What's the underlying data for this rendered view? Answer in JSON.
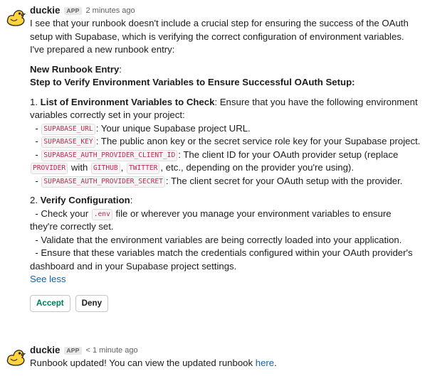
{
  "messages": [
    {
      "username": "duckie",
      "badge": "APP",
      "timestamp": "2 minutes ago",
      "intro": "I see that your runbook doesn't include a crucial step for ensuring the success of the OAuth setup with Supabase, which is verifying the correct configuration of environment variables. I've prepared a new runbook entry:",
      "entry_label": "New Runbook Entry",
      "entry_colon": ":",
      "step_title": "Step to Verify Environment Variables to Ensure Successful OAuth Setup:",
      "section1": {
        "number": "1. ",
        "title": "List of Environment Variables to Check",
        "text": ": Ensure that you have the following environment variables correctly set in your project:",
        "items": [
          {
            "dash": "- ",
            "code": "SUPABASE_URL",
            "text": ": Your unique Supabase project URL."
          },
          {
            "dash": "- ",
            "code": "SUPABASE_KEY",
            "text": ": The public anon key or the secret service role key for your Supabase project."
          },
          {
            "dash": "- ",
            "code": "SUPABASE_AUTH_PROVIDER_CLIENT_ID",
            "text": ": The client ID for your OAuth provider setup (replace ",
            "code2": "PROVIDER",
            "text2": " with ",
            "code3": "GITHUB",
            "text3": ", ",
            "code4": "TWITTER",
            "text4": ", etc., depending on the provider you're using)."
          },
          {
            "dash": "- ",
            "code": "SUPABASE_AUTH_PROVIDER_SECRET",
            "text": ": The client secret for your OAuth setup with the provider."
          }
        ]
      },
      "section2": {
        "number": "2. ",
        "title": "Verify Configuration",
        "colon": ":",
        "items": [
          {
            "text_before": "- Check your ",
            "code": ".env",
            "text_after": " file or wherever you manage your environment variables to ensure they're correctly set."
          },
          {
            "text": "- Validate that the environment variables are being correctly loaded into your application."
          },
          {
            "text": "- Ensure that these variables match the credentials configured within your OAuth provider's dashboard and in your Supabase project settings."
          }
        ]
      },
      "see_less": "See less",
      "buttons": {
        "accept": "Accept",
        "deny": "Deny"
      }
    },
    {
      "username": "duckie",
      "badge": "APP",
      "timestamp": "< 1 minute ago",
      "text": "Runbook updated! You can view the updated runbook ",
      "link": "here",
      "end": "."
    }
  ],
  "colors": {
    "link": "#1264a3",
    "code": "#c0294f",
    "accept": "#007a5a",
    "duck": "#ffd23f"
  }
}
